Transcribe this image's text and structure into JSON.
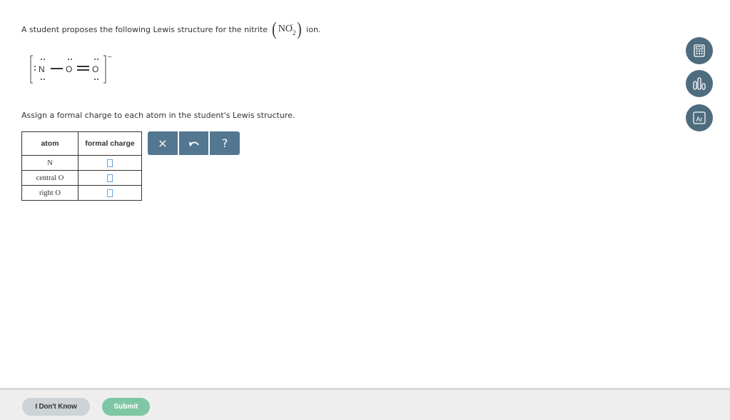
{
  "question": {
    "prompt_before": "A student proposes the following Lewis structure for the nitrite",
    "formula_element": "NO",
    "formula_subscript": "2",
    "formula_charge": "−",
    "prompt_after": "ion.",
    "instruction": "Assign a formal charge to each atom in the student's Lewis structure."
  },
  "lewis": {
    "atom_n": "N",
    "atom_central_o": "O",
    "atom_right_o": "O",
    "overall_charge": "−"
  },
  "table": {
    "headers": [
      "atom",
      "formal charge"
    ],
    "rows": [
      {
        "atom": "N",
        "value": ""
      },
      {
        "atom": "central O",
        "value": ""
      },
      {
        "atom": "right O",
        "value": ""
      }
    ]
  },
  "toolbar": {
    "clear_symbol": "×",
    "undo_symbol": "↶",
    "help_symbol": "?"
  },
  "tools": {
    "periodic_label": "Ar"
  },
  "footer": {
    "dont_know_label": "I Don't Know",
    "submit_label": "Submit"
  },
  "colors": {
    "toolbar_bg": "#547791",
    "tool_circle": "#4e6c7e",
    "submit_bg": "#7fc7a4",
    "input_border": "#6aa1d8"
  }
}
